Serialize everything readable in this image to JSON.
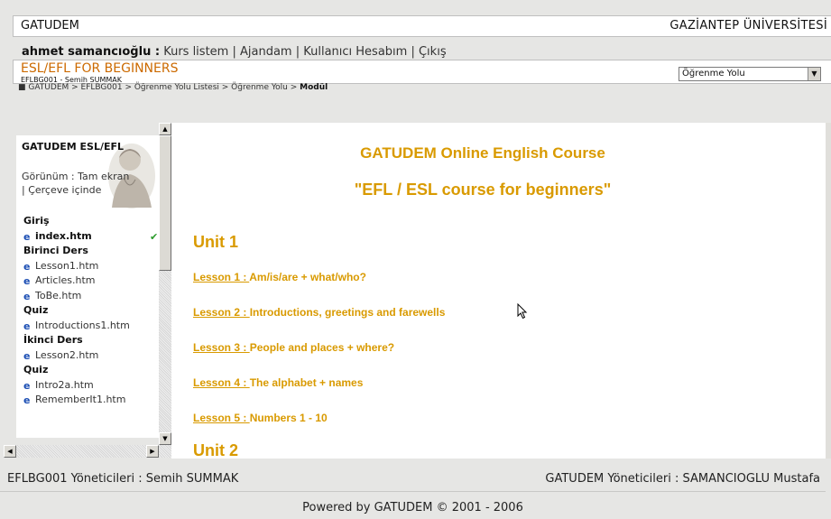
{
  "header": {
    "brand": "GATUDEM",
    "university": "GAZİANTEP ÜNİVERSİTESİ",
    "user_name": "ahmet samancıoğlu :",
    "nav": [
      "Kurs listem",
      "Ajandam",
      "Kullanıcı Hesabım",
      "Çıkış"
    ],
    "nav_sep": " | "
  },
  "course": {
    "title": "ESL/EFL FOR BEGINNERS",
    "subtitle": "EFLBG001 - Semih SUMMAK",
    "select_value": "Öğrenme Yolu",
    "breadcrumb": "GATUDEM > EFLBG001 > Öğrenme Yolu Listesi > Öğrenme Yolu > ",
    "breadcrumb_current": "Modül"
  },
  "sidebar": {
    "title": "GATUDEM ESL/EFL",
    "view_label": "Görünüm : Tam ekran",
    "view_label2": "| Çerçeve içinde",
    "items": [
      {
        "type": "section",
        "label": "Giriş"
      },
      {
        "type": "file",
        "label": "index.htm",
        "selected": true,
        "done": true
      },
      {
        "type": "section",
        "label": "Birinci Ders"
      },
      {
        "type": "file",
        "label": "Lesson1.htm"
      },
      {
        "type": "file",
        "label": "Articles.htm"
      },
      {
        "type": "file",
        "label": "ToBe.htm"
      },
      {
        "type": "section",
        "label": "Quiz"
      },
      {
        "type": "file",
        "label": "Introductions1.htm"
      },
      {
        "type": "section",
        "label": "İkinci Ders"
      },
      {
        "type": "file",
        "label": "Lesson2.htm"
      },
      {
        "type": "section",
        "label": "Quiz"
      },
      {
        "type": "file",
        "label": "Intro2a.htm"
      },
      {
        "type": "file",
        "label": "RememberIt1.htm"
      }
    ]
  },
  "content": {
    "title1": "GATUDEM Online English Course",
    "title2": "\"EFL / ESL course for beginners\"",
    "unit1": "Unit 1",
    "unit2": "Unit 2",
    "lessons": [
      {
        "link": "Lesson 1  :  ",
        "text": "Am/is/are + what/who?"
      },
      {
        "link": "Lesson 2  :  ",
        "text": "Introductions, greetings and farewells"
      },
      {
        "link": "Lesson 3  :  ",
        "text": "People and places + where?"
      },
      {
        "link": "Lesson 4  :  ",
        "text": "The alphabet + names"
      },
      {
        "link": "Lesson 5  :  ",
        "text": " Numbers 1 - 10"
      }
    ]
  },
  "footer": {
    "left_label": "EFLBG001 Yöneticileri : ",
    "left_name": "Semih SUMMAK",
    "right_label": "GATUDEM Yöneticileri : ",
    "right_name": "SAMANCIOGLU Mustafa",
    "powered": "Powered by GATUDEM © 2001 - 2006"
  },
  "colors": {
    "accent": "#d99a00",
    "course_title": "#cc6a00"
  }
}
